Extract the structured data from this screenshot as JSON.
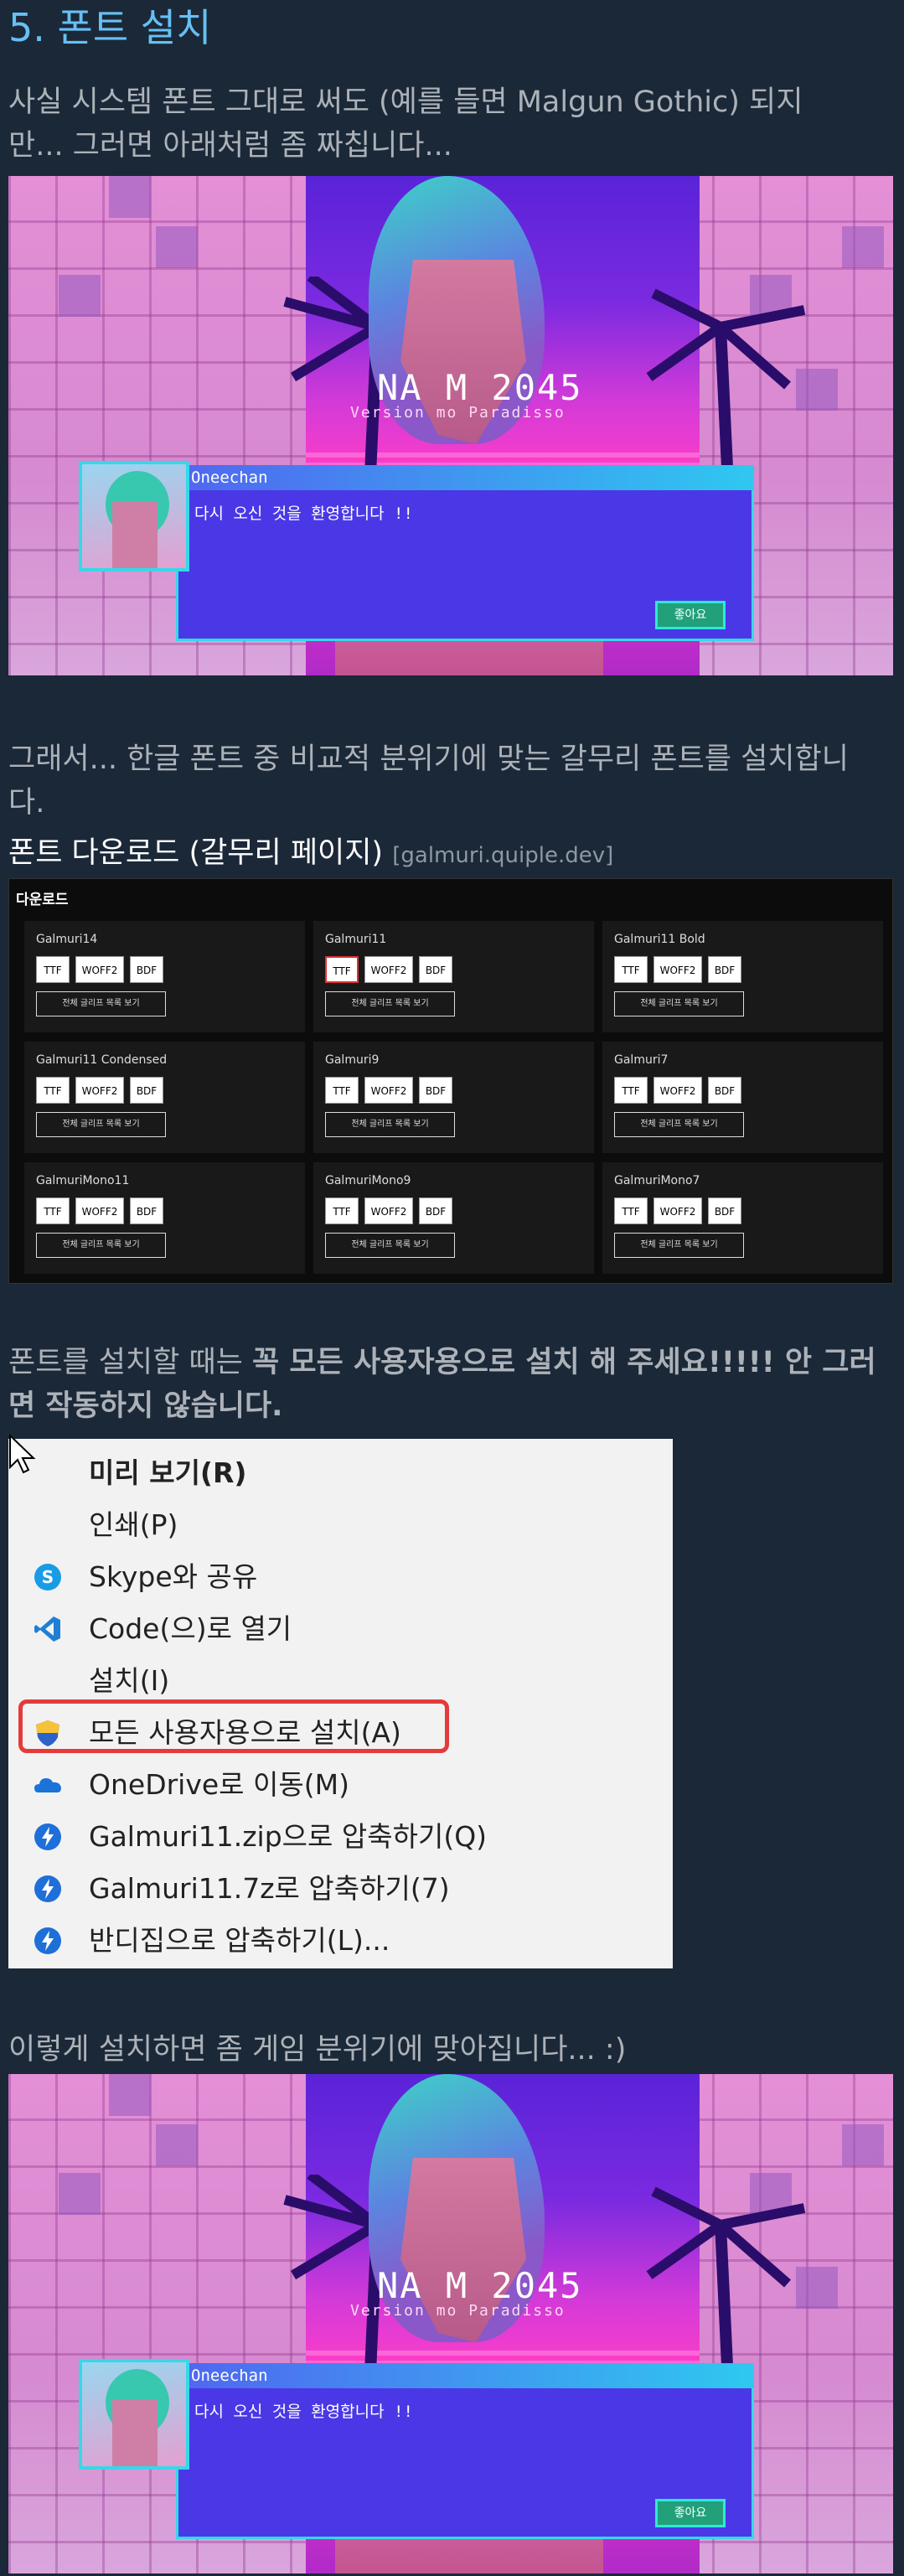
{
  "section": {
    "heading": "5. 폰트 설치",
    "intro_line1": "사실 시스템 폰트 그대로 써도 (예를 들면 Malgun Gothic) 되지",
    "intro_line2": "만... 그러면 아래처럼 좀 짜칩니다...",
    "para2_line1": "그래서... 한글 폰트 중 비교적 분위기에 맞는 갈무리 폰트를 설치합니",
    "para2_line2": "다.",
    "download_title": "폰트 다운로드 (갈무리 페이지)",
    "download_link": "[galmuri.quiple.dev]",
    "para3_line1_normal": "폰트를 설치할 때는 ",
    "para3_line1_bold": "꼭 모든 사용자용으로 설치 해 주세요!!!!! 안 그러",
    "para3_line2_bold": "면 작동하지 않습니다.",
    "outro": "이렇게 설치하면 좀 게임 분위기에 맞아집니다... :)"
  },
  "game_screens": {
    "title": "NA  M 2045",
    "subtitle": "Version      mo Paradisso",
    "speaker": "Oneechan",
    "message": "다시 오신 것을 환영합니다 !!",
    "ok_button": "좋아요"
  },
  "download_panel": {
    "title": "다운로드",
    "button_ttf": "TTF",
    "button_woff2": "WOFF2",
    "button_bdf": "BDF",
    "button_all": "전체 글리프 목록 보기",
    "fonts": [
      "Galmuri14",
      "Galmuri11",
      "Galmuri11 Bold",
      "Galmuri11 Condensed",
      "Galmuri9",
      "Galmuri7",
      "GalmuriMono11",
      "GalmuriMono9",
      "GalmuriMono7"
    ]
  },
  "context_menu": {
    "items": [
      {
        "label": "미리 보기(R)",
        "icon": "none",
        "bold": true
      },
      {
        "label": "인쇄(P)",
        "icon": "none"
      },
      {
        "label": "Skype와 공유",
        "icon": "skype-icon"
      },
      {
        "label": "Code(으)로 열기",
        "icon": "vscode-icon"
      },
      {
        "label": "설치(I)",
        "icon": "none"
      },
      {
        "label": "모든 사용자용으로 설치(A)",
        "icon": "shield-icon"
      },
      {
        "label": "OneDrive로 이동(M)",
        "icon": "onedrive-icon"
      },
      {
        "label": "Galmuri11.zip으로 압축하기(Q)",
        "icon": "bandizip-icon"
      },
      {
        "label": "Galmuri11.7z로 압축하기(7)",
        "icon": "bandizip-icon"
      },
      {
        "label": "반디집으로 압축하기(L)...",
        "icon": "bandizip-icon"
      }
    ]
  },
  "colors": {
    "page_bg": "#1b2838",
    "heading": "#66c0f4",
    "text": "#acb2b8",
    "highlight": "#e53a3a"
  }
}
